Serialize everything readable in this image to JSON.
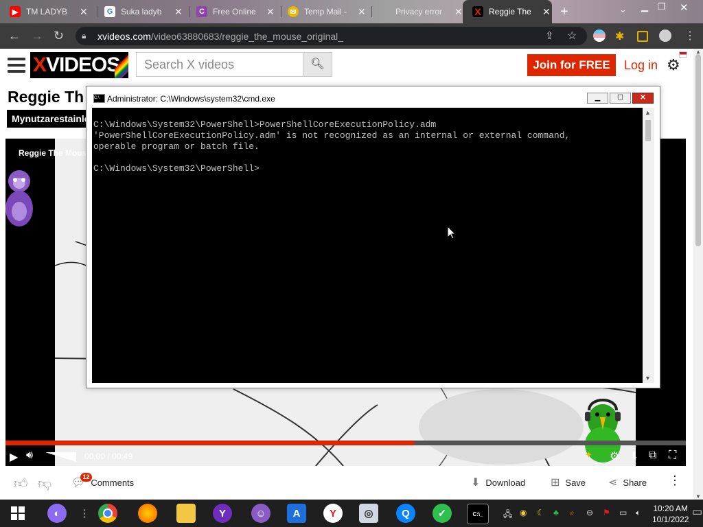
{
  "browser": {
    "tabs": [
      {
        "title": "TM LADYB",
        "icon": "youtube-icon",
        "color": "#ff0000"
      },
      {
        "title": "Suka ladyb",
        "icon": "google-icon",
        "color": "#4285f4"
      },
      {
        "title": "Free Online",
        "icon": "c-icon",
        "color": "#8e44ad"
      },
      {
        "title": "Temp Mail -",
        "icon": "mail-icon",
        "color": "#e6b800"
      },
      {
        "title": "Privacy error",
        "icon": "none",
        "color": "#888888"
      },
      {
        "title": "Reggie The",
        "icon": "x-icon",
        "color": "#de2600"
      }
    ],
    "url_host": "xvideos.com",
    "url_path": "/video63880683/reggie_the_mouse_original_"
  },
  "site": {
    "logo_x": "X",
    "logo_rest": "VIDEOS",
    "search_placeholder": "Search X videos",
    "join_label": "Join for FREE",
    "login_label": "Log in"
  },
  "video": {
    "title": "Reggie Th",
    "uploader": "Mynutzarestainle",
    "player_title": "Reggie The Mous",
    "time": "00:00 / 00:49",
    "progress": 0.6
  },
  "actions": {
    "comments_count": "12",
    "comments_label": "Comments",
    "download_label": "Download",
    "save_label": "Save",
    "share_label": "Share"
  },
  "cmd": {
    "title": "Administrator: C:\\Windows\\system32\\cmd.exe",
    "lines": [
      "C:\\Windows\\System32\\PowerShell>PowerShellCoreExecutionPolicy.adm",
      "'PowerShellCoreExecutionPolicy.adm' is not recognized as an internal or external command,",
      "operable program or batch file.",
      "",
      "C:\\Windows\\System32\\PowerShell>"
    ]
  },
  "taskbar": {
    "time": "10:20 AM",
    "date": "10/1/2022"
  },
  "colors": {
    "brand_red": "#de2600",
    "chrome_dark": "#3c3c3c"
  }
}
